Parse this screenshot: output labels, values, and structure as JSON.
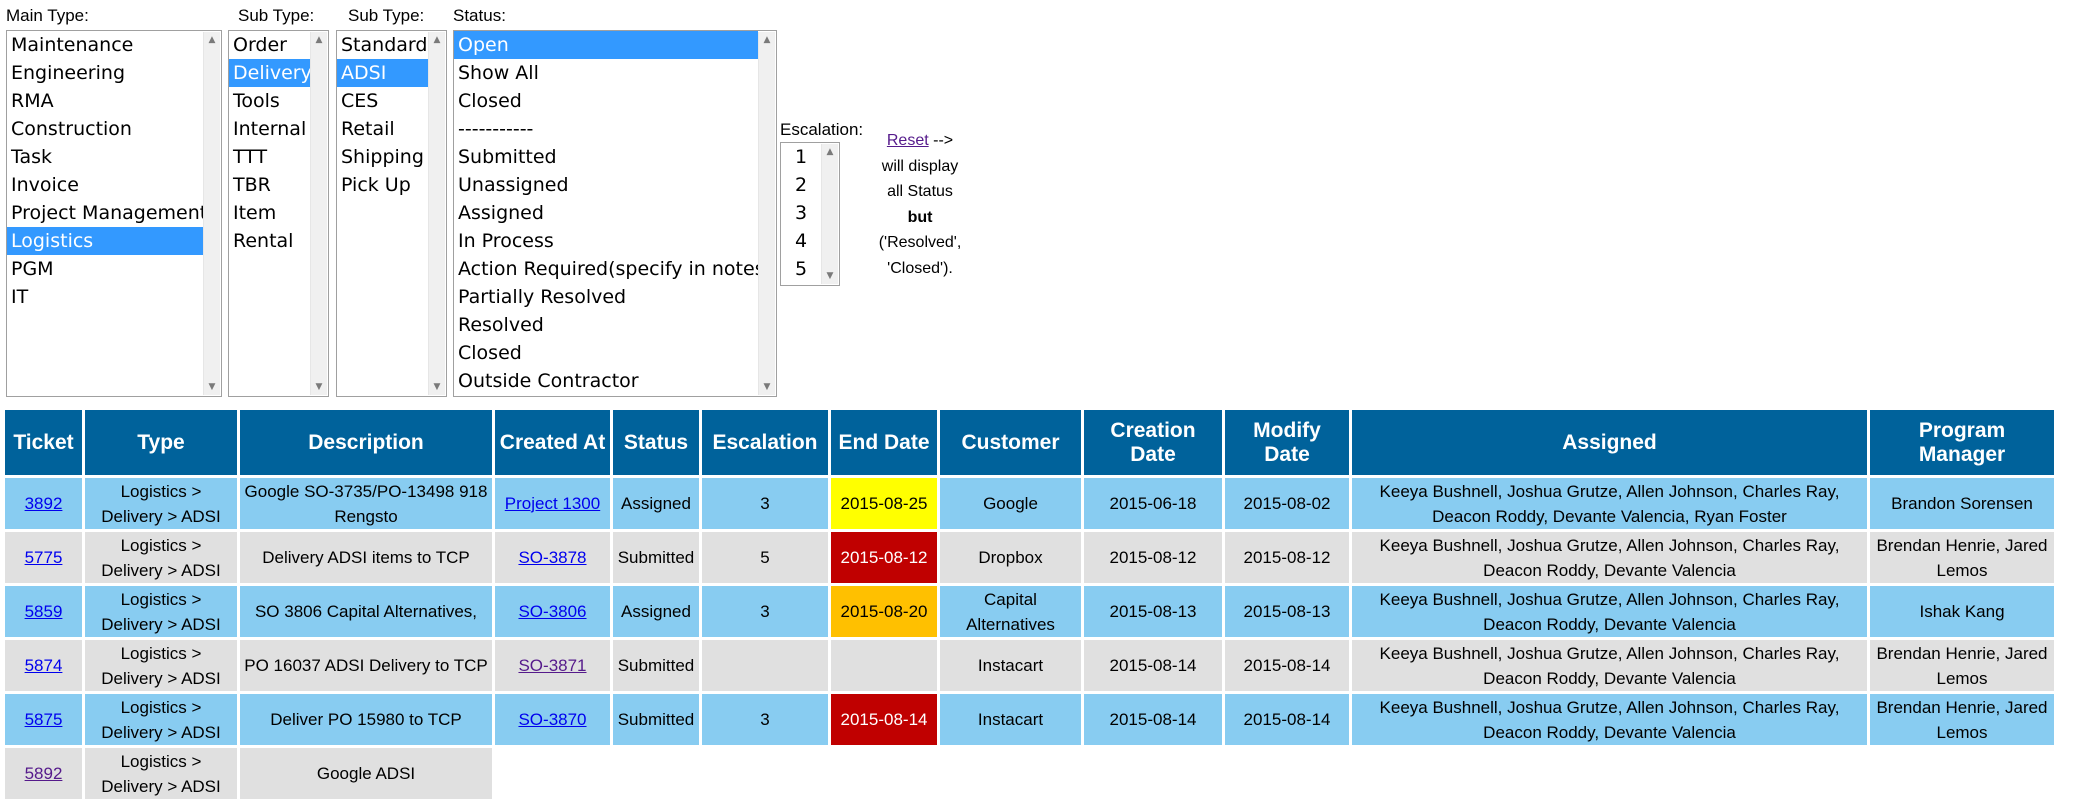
{
  "filters": {
    "main_type": {
      "label": "Main Type:",
      "options": [
        "Maintenance",
        "Engineering",
        "RMA",
        "Construction",
        "Task",
        "Invoice",
        "Project Management",
        "Logistics",
        "PGM",
        "IT"
      ],
      "selected": "Logistics"
    },
    "sub_type_1": {
      "label": "Sub Type:",
      "options": [
        "Order",
        "Delivery",
        "Tools",
        "Internal",
        "TTT",
        "TBR",
        "Item",
        "Rental"
      ],
      "selected": "Delivery"
    },
    "sub_type_2": {
      "label": "Sub Type:",
      "options": [
        "Standard",
        "ADSI",
        "CES",
        "Retail",
        "Shipping",
        "Pick Up"
      ],
      "selected": "ADSI"
    },
    "status": {
      "label": "Status:",
      "options": [
        "Open",
        "Show All",
        "Closed",
        "-----------",
        "Submitted",
        "Unassigned",
        "Assigned",
        "In Process",
        "Action Required(specify in notes)",
        "Partially Resolved",
        "Resolved",
        "Closed",
        "Outside Contractor"
      ],
      "selected": "Open"
    },
    "escalation": {
      "label": "Escalation:",
      "options": [
        "1",
        "2",
        "3",
        "4",
        "5"
      ]
    }
  },
  "note": {
    "reset_link": "Reset",
    "arrow": " -->",
    "line2": "will display",
    "line3": "all Status",
    "line4": "but",
    "line5": "('Resolved',",
    "line6": "'Closed')."
  },
  "table": {
    "headers": {
      "ticket": "Ticket",
      "type": "Type",
      "description": "Description",
      "created_at": "Created At",
      "status": "Status",
      "escalation": "Escalation",
      "end_date": "End Date",
      "customer": "Customer",
      "creation_date": "Creation Date",
      "modify_date": "Modify Date",
      "assigned": "Assigned",
      "program_manager": "Program Manager"
    },
    "rows": [
      {
        "ticket": "3892",
        "type": "Logistics > Delivery > ADSI",
        "description": "Google SO-3735/PO-13498 918 Rengsto",
        "created_at": "Project 1300",
        "status": "Assigned",
        "escalation": "3",
        "end_date": "2015-08-25",
        "customer": "Google",
        "creation_date": "2015-06-18",
        "modify_date": "2015-08-02",
        "assigned": "Keeya Bushnell, Joshua Grutze, Allen Johnson, Charles Ray, Deacon Roddy, Devante Valencia, Ryan Foster",
        "program_manager": "Brandon Sorensen",
        "end_date_color": "#ffff00"
      },
      {
        "ticket": "5775",
        "type": "Logistics > Delivery > ADSI",
        "description": "Delivery ADSI items to TCP",
        "created_at": "SO-3878",
        "status": "Submitted",
        "escalation": "5",
        "end_date": "2015-08-12",
        "customer": "Dropbox",
        "creation_date": "2015-08-12",
        "modify_date": "2015-08-12",
        "assigned": "Keeya Bushnell, Joshua Grutze, Allen Johnson, Charles Ray, Deacon Roddy, Devante Valencia",
        "program_manager": "Brendan Henrie, Jared Lemos",
        "end_date_color": "#c00000"
      },
      {
        "ticket": "5859",
        "type": "Logistics > Delivery > ADSI",
        "description": "SO 3806  Capital Alternatives,",
        "created_at": "SO-3806",
        "status": "Assigned",
        "escalation": "3",
        "end_date": "2015-08-20",
        "customer": "Capital Alternatives",
        "creation_date": "2015-08-13",
        "modify_date": "2015-08-13",
        "assigned": "Keeya Bushnell, Joshua Grutze, Allen Johnson, Charles Ray, Deacon Roddy, Devante Valencia",
        "program_manager": "Ishak Kang",
        "end_date_color": "#ffc000"
      },
      {
        "ticket": "5874",
        "type": "Logistics > Delivery > ADSI",
        "description": "PO 16037 ADSI Delivery to TCP",
        "created_at": "SO-3871",
        "status": "Submitted",
        "escalation": "",
        "end_date": "",
        "customer": "Instacart",
        "creation_date": "2015-08-14",
        "modify_date": "2015-08-14",
        "assigned": "Keeya Bushnell, Joshua Grutze, Allen Johnson, Charles Ray, Deacon Roddy, Devante Valencia",
        "program_manager": "Brendan Henrie, Jared Lemos"
      },
      {
        "ticket": "5875",
        "type": "Logistics > Delivery > ADSI",
        "description": "Deliver PO 15980 to TCP",
        "created_at": "SO-3870",
        "status": "Submitted",
        "escalation": "3",
        "end_date": "2015-08-14",
        "customer": "Instacart",
        "creation_date": "2015-08-14",
        "modify_date": "2015-08-14",
        "assigned": "Keeya Bushnell, Joshua Grutze, Allen Johnson, Charles Ray, Deacon Roddy, Devante Valencia",
        "program_manager": "Brendan Henrie, Jared Lemos",
        "end_date_color": "#c00000"
      },
      {
        "ticket": "5892",
        "type": "Logistics > Delivery > ADSI",
        "description": "Google ADSI"
      }
    ]
  }
}
